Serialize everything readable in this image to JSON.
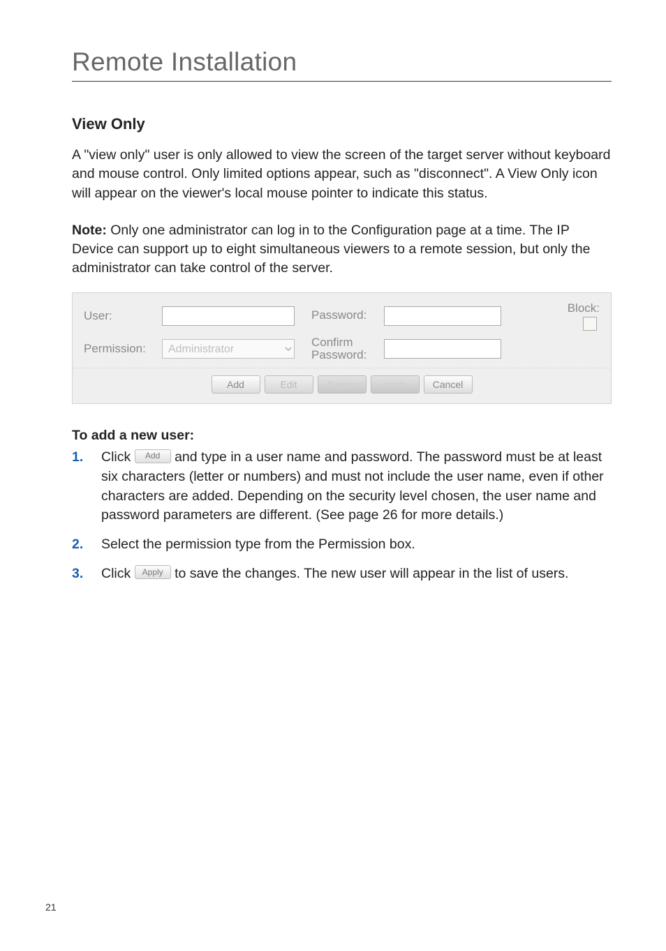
{
  "header": {
    "title": "Remote Installation"
  },
  "section": {
    "heading": "View Only",
    "para1": "A \"view only\" user is only allowed to view the screen of the target server without keyboard and mouse control. Only limited options appear, such as \"disconnect\". A View Only icon will appear on the viewer's local mouse pointer to indicate this status.",
    "note_label": "Note:",
    "note_body": " Only one administrator can log in to the Configuration page at a time. The IP Device can support up to eight simultaneous viewers to a remote session, but only the administrator can take control of the server."
  },
  "form": {
    "user_label": "User:",
    "user_value": "",
    "password_label": "Password:",
    "password_value": "",
    "permission_label": "Permission:",
    "permission_value": "Administrator",
    "confirm_label": "Confirm Password:",
    "confirm_value": "",
    "block_label": "Block:",
    "buttons": {
      "add": "Add",
      "edit": "Edit",
      "delete": "Delete",
      "apply": "Apply",
      "cancel": "Cancel"
    }
  },
  "instructions": {
    "heading": "To add a new user:",
    "step1_pre": "Click ",
    "step1_btn": "Add",
    "step1_post": " and type in a user name and password. The password must be at least six characters (letter or numbers) and must not include the user name, even if other characters are added. Depending on the security level chosen, the user name and password parameters are different. (See page 26 for more details.)",
    "step2": "Select the permission type from the Permission box.",
    "step3_pre": "Click ",
    "step3_btn": "Apply",
    "step3_post": " to save the changes. The new user will appear in the list of users."
  },
  "footer": {
    "page_number": "21"
  }
}
